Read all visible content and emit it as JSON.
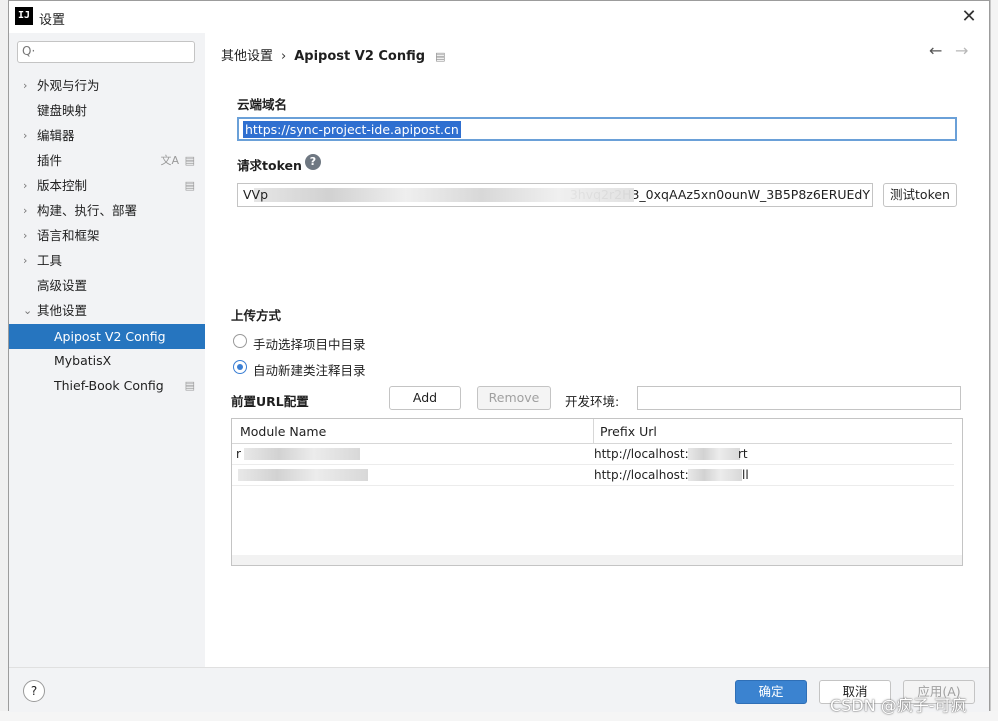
{
  "window": {
    "title": "设置",
    "app_icon": "IJ",
    "close": "✕"
  },
  "search": {
    "placeholder": "Q·"
  },
  "sidebar": {
    "items": [
      {
        "label": "外观与行为",
        "chevron": true
      },
      {
        "label": "键盘映射",
        "chevron": false
      },
      {
        "label": "编辑器",
        "chevron": true
      },
      {
        "label": "插件",
        "chevron": false
      },
      {
        "label": "版本控制",
        "chevron": true
      },
      {
        "label": "构建、执行、部署",
        "chevron": true
      },
      {
        "label": "语言和框架",
        "chevron": true
      },
      {
        "label": "工具",
        "chevron": true
      },
      {
        "label": "高级设置",
        "chevron": false
      },
      {
        "label": "其他设置",
        "chevron": "expanded"
      },
      {
        "label": "Apipost V2 Config",
        "selected": true
      },
      {
        "label": "MybatisX"
      },
      {
        "label": "Thief-Book Config"
      }
    ]
  },
  "breadcrumb": {
    "parent": "其他设置",
    "separator": "›",
    "current": "Apipost V2 Config"
  },
  "nav": {
    "back": "←",
    "forward": "→"
  },
  "form": {
    "domain_label": "云端域名",
    "domain_value": "https://sync-project-ide.apipost.cn",
    "token_label": "请求token",
    "token_help": "?",
    "token_prefix": "VVp",
    "token_value_visible": "3hvq2r2H3_0xqAAz5xn0ounW_3B5P8z6ERUEdY",
    "test_token_button": "测试token",
    "upload_label": "上传方式",
    "upload_options": [
      {
        "label": "手动选择项目中目录",
        "selected": false
      },
      {
        "label": "自动新建类注释目录",
        "selected": true
      }
    ],
    "prefix_url_label": "前置URL配置",
    "add_button": "Add",
    "remove_button": "Remove",
    "env_label": "开发环境:",
    "env_value": ""
  },
  "table": {
    "columns": [
      "Module Name",
      "Prefix Url"
    ],
    "rows": [
      {
        "module": "r",
        "prefix": "http://localhost:9",
        "suffix": "rt"
      },
      {
        "module": "",
        "prefix": "http://localhost:9",
        "suffix": "ll"
      }
    ]
  },
  "footer": {
    "help": "?",
    "ok": "确定",
    "cancel": "取消",
    "apply": "应用(A)"
  },
  "watermark": "CSDN @疯子-可疯",
  "colors": {
    "accent": "#2675bf",
    "sidebar_bg": "#f2f3f5",
    "primary_button": "#3b83d0"
  }
}
